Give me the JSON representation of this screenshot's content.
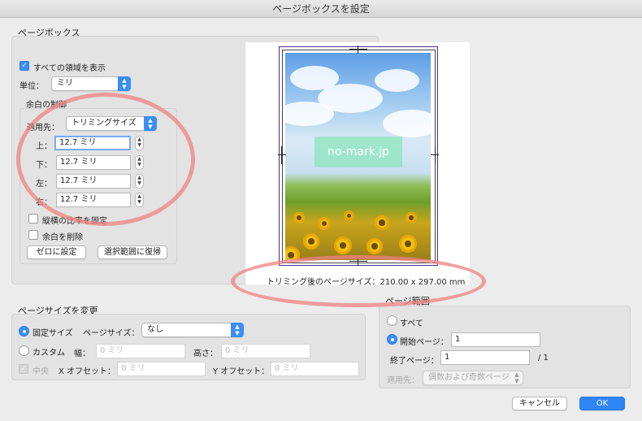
{
  "window": {
    "title": "ページボックスを設定"
  },
  "page_box": {
    "group_label": "ページボックス",
    "show_all_label": "すべての領域を表示",
    "show_all_checked": true,
    "unit_label": "単位：",
    "unit_value": "ミリ",
    "margin": {
      "group_label": "余白の制御",
      "apply_label": "適用先：",
      "apply_value": "トリミングサイズ",
      "top_label": "上：",
      "top_value": "12.7 ミリ",
      "bottom_label": "下：",
      "bottom_value": "12.7 ミリ",
      "left_label": "左：",
      "left_value": "12.7 ミリ",
      "right_label": "右：",
      "right_value": "12.7 ミリ",
      "ratio_label": "縦横の比率を固定",
      "remove_label": "余白を削除",
      "zero_button": "ゼロに設定",
      "restore_button": "選択範囲に復帰"
    }
  },
  "preview": {
    "watermark": "no-mark.jp",
    "trim_size_text": "トリミング後のページサイズ：210.00 x 297.00 mm"
  },
  "page_size": {
    "group_label": "ページサイズを変更",
    "fixed_label": "固定サイズ",
    "page_size_label": "ページサイズ：",
    "page_size_value": "なし",
    "custom_label": "カスタム",
    "width_label": "幅：",
    "width_placeholder": "0 ミリ",
    "height_label": "高さ：",
    "height_placeholder": "0 ミリ",
    "center_label": "中央",
    "x_offset_label": "X オフセット：",
    "x_offset_placeholder": "0 ミリ",
    "y_offset_label": "Y オフセット：",
    "y_offset_placeholder": "0 ミリ"
  },
  "page_range": {
    "group_label": "ページ範囲",
    "all_label": "すべて",
    "start_label": "開始ページ：",
    "start_value": "1",
    "end_label": "終了ページ：",
    "end_value": "1",
    "total": "/ 1",
    "apply_label": "適用先：",
    "apply_value": "偶数および奇数ページ"
  },
  "buttons": {
    "cancel": "キャンセル",
    "ok": "OK"
  },
  "colors": {
    "accent": "#3a8ef6",
    "highlight_ring": "#f08282"
  }
}
